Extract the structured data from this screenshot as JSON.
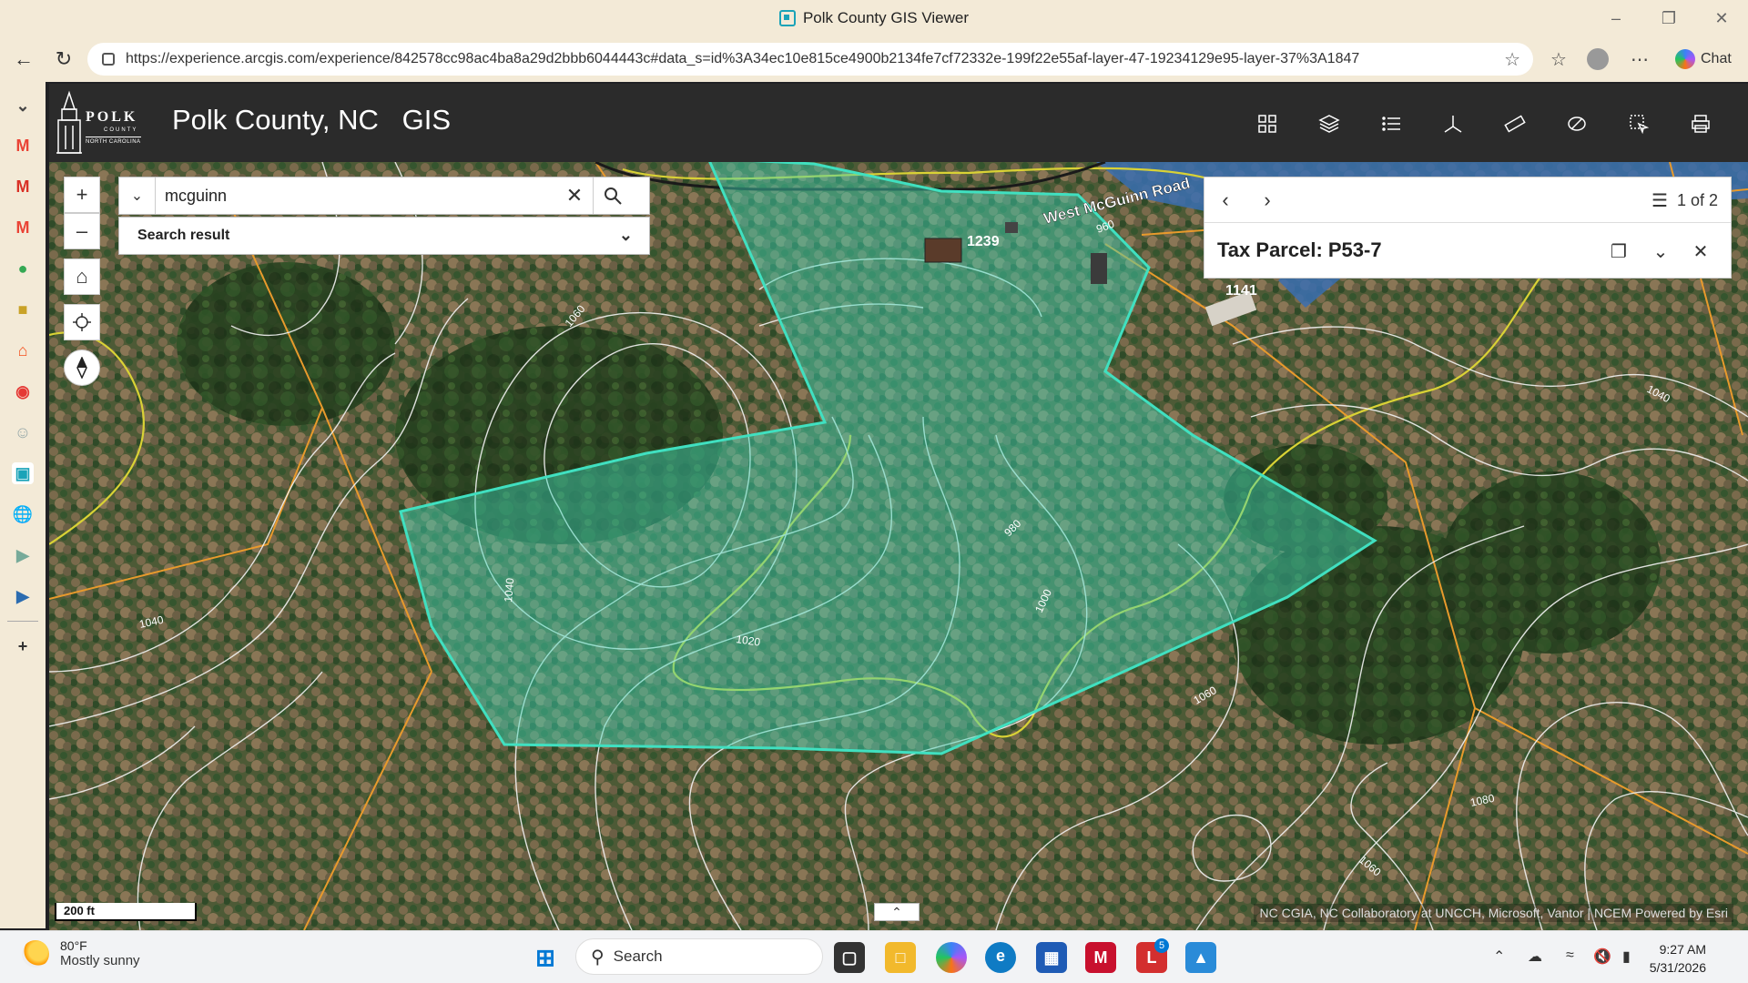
{
  "window": {
    "title": "Polk County GIS Viewer"
  },
  "browser": {
    "url": "https://experience.arcgis.com/experience/842578cc98ac4ba8a29d2bbb6044443c#data_s=id%3A34ec10e815ce4900b2134fe7cf72332e-199f22e55af-layer-47-19234129e95-layer-37%3A1847",
    "chat_label": "Chat"
  },
  "app": {
    "title": "Polk County, NC   GIS",
    "logo_text": "POLK",
    "logo_sub": "COUNTY",
    "logo_state": "NORTH CAROLINA"
  },
  "search": {
    "value": "mcguinn",
    "result_label": "Search result"
  },
  "popup": {
    "pager": "1 of 2",
    "title": "Tax Parcel: P53-7"
  },
  "map": {
    "road_label": "West McGuinn Road",
    "address_labels": [
      "1239",
      "1141"
    ],
    "contour_labels": [
      "1060",
      "1040",
      "960",
      "1040",
      "980",
      "1000",
      "1040",
      "1020",
      "1060",
      "1080",
      "1060"
    ],
    "scale": "200 ft",
    "attribution": "NC CGIA, NC Collaboratory at UNCCH, Microsoft, Vantor | NCEM  Powered by Esri"
  },
  "taskbar": {
    "weather_temp": "80°F",
    "weather_desc": "Mostly sunny",
    "search_label": "Search",
    "time": "9:27 AM",
    "date": "5/31/2026",
    "badge": "5"
  },
  "colors": {
    "parcel_fill": "#3fd7b8",
    "parcel_stroke": "#40e0c0",
    "contour": "#ffffff",
    "boundary": "#e89a2c"
  }
}
